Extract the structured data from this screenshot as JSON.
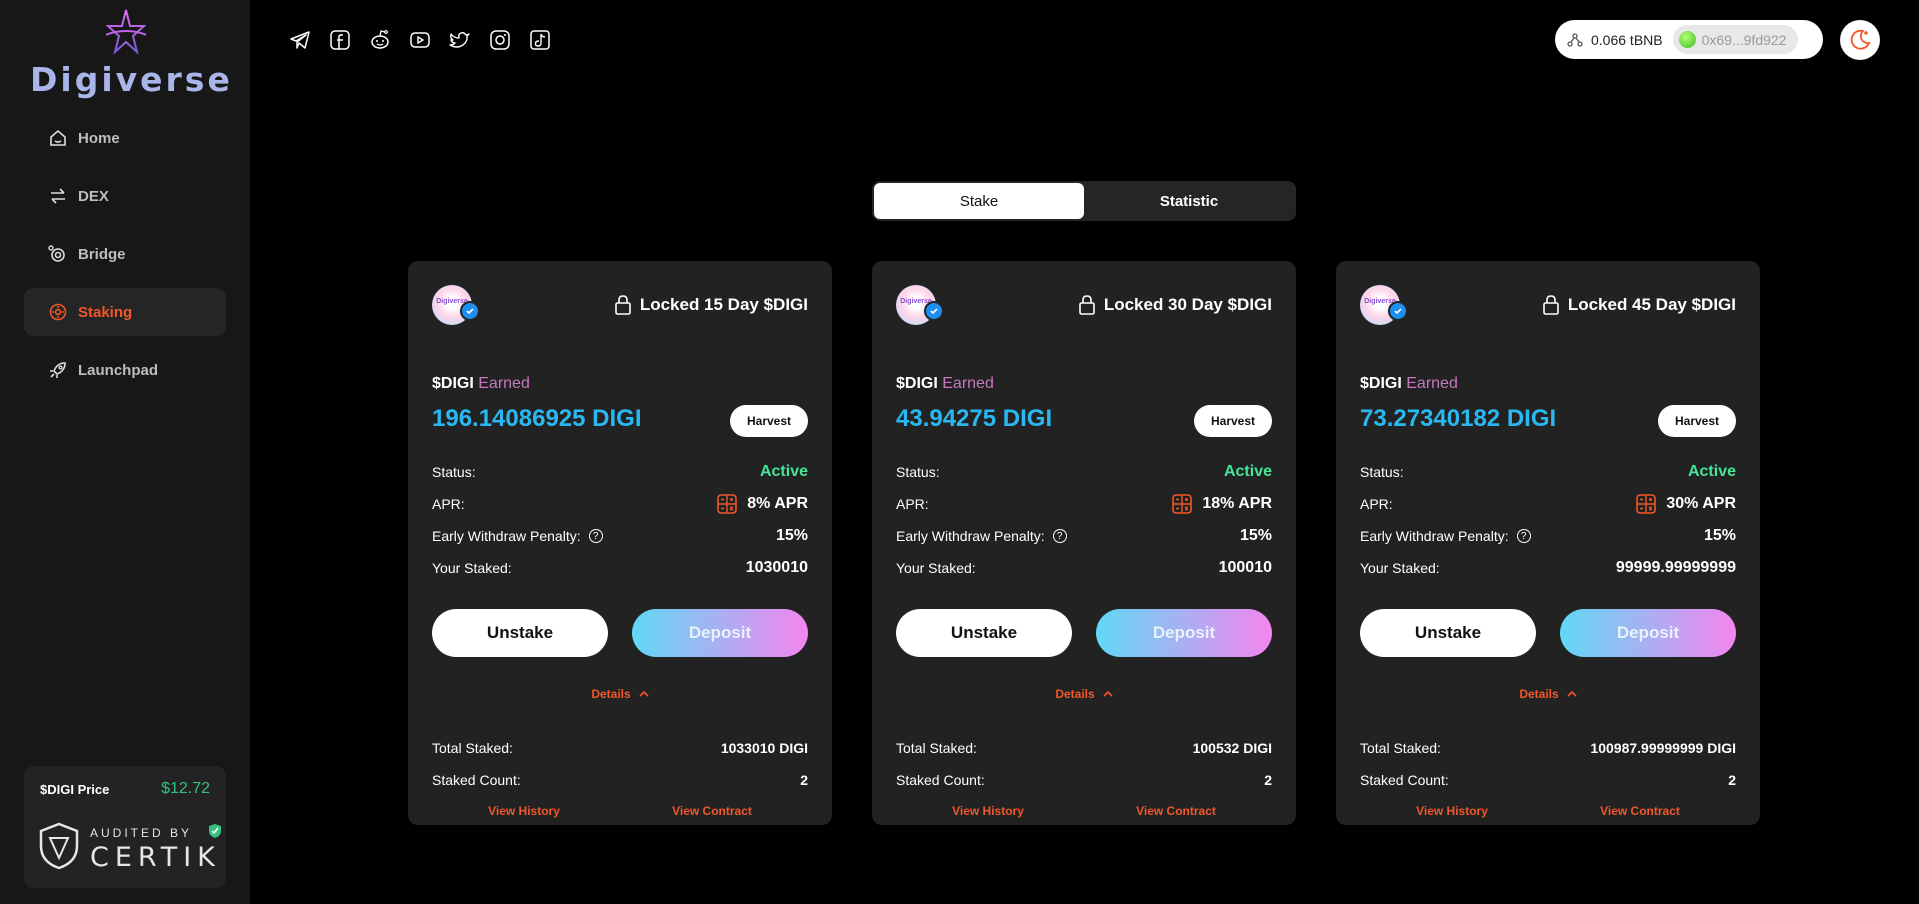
{
  "app": {
    "brand": "Digiverse"
  },
  "sidebar": {
    "items": [
      {
        "label": "Home",
        "icon": "home-icon",
        "active": false
      },
      {
        "label": "DEX",
        "icon": "swap-icon",
        "active": false
      },
      {
        "label": "Bridge",
        "icon": "bridge-icon",
        "active": false
      },
      {
        "label": "Staking",
        "icon": "staking-icon",
        "active": true
      },
      {
        "label": "Launchpad",
        "icon": "rocket-icon",
        "active": false
      }
    ],
    "price_label": "$DIGI Price",
    "price_value": "$12.72",
    "audited_label": "AUDITED BY",
    "audited_brand": "CERTIK"
  },
  "header": {
    "socials": [
      "telegram-icon",
      "facebook-icon",
      "reddit-icon",
      "youtube-icon",
      "twitter-icon",
      "instagram-icon",
      "tiktok-icon"
    ],
    "balance": "0.066 tBNB",
    "address": "0x69...9fd922"
  },
  "tabs": [
    {
      "label": "Stake",
      "active": true
    },
    {
      "label": "Statistic",
      "active": false
    }
  ],
  "labels": {
    "token": "$DIGI",
    "earned": "Earned",
    "harvest": "Harvest",
    "status": "Status:",
    "apr": "APR:",
    "penalty": "Early Withdraw Penalty:",
    "your_staked": "Your Staked:",
    "unstake": "Unstake",
    "deposit": "Deposit",
    "details": "Details",
    "total_staked": "Total Staked:",
    "staked_count": "Staked Count:",
    "view_history": "View History",
    "view_contract": "View Contract",
    "avatar_text": "Digiverse"
  },
  "pools": [
    {
      "title": "Locked 15 Day $DIGI",
      "earned": "196.14086925 DIGI",
      "status": "Active",
      "apr": "8% APR",
      "penalty": "15%",
      "your_staked": "1030010",
      "total_staked": "1033010 DIGI",
      "staked_count": "2"
    },
    {
      "title": "Locked 30 Day $DIGI",
      "earned": "43.94275 DIGI",
      "status": "Active",
      "apr": "18% APR",
      "penalty": "15%",
      "your_staked": "100010",
      "total_staked": "100532 DIGI",
      "staked_count": "2"
    },
    {
      "title": "Locked 45 Day $DIGI",
      "earned": "73.27340182 DIGI",
      "status": "Active",
      "apr": "30% APR",
      "penalty": "15%",
      "your_staked": "99999.99999999",
      "total_staked": "100987.99999999 DIGI",
      "staked_count": "2"
    }
  ],
  "colors": {
    "accent": "#f0582b",
    "earned_value": "#2ab8f2",
    "status_active": "#47e59a",
    "price": "#35c07d"
  }
}
